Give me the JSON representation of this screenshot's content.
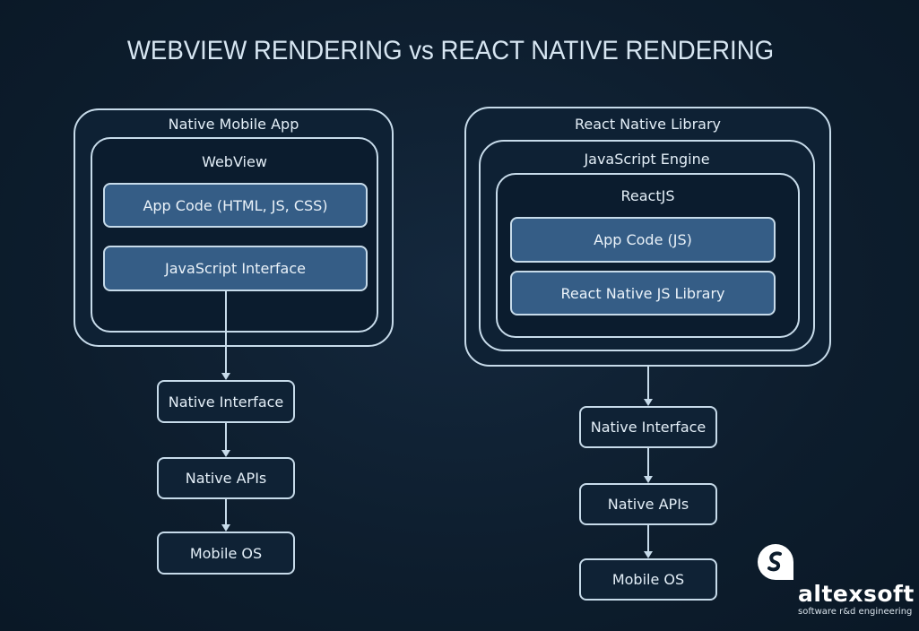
{
  "title": "WEBVIEW RENDERING vs REACT NATIVE RENDERING",
  "left": {
    "outer_label": "Native Mobile App",
    "inner_label": "WebView",
    "blocks": [
      "App Code (HTML, JS, CSS)",
      "JavaScript Interface"
    ],
    "chain": [
      "Native Interface",
      "Native APIs",
      "Mobile OS"
    ]
  },
  "right": {
    "outer_label": "React Native Library",
    "middle_label": "JavaScript Engine",
    "inner_label": "ReactJS",
    "blocks": [
      "App Code (JS)",
      "React Native JS Library"
    ],
    "chain": [
      "Native Interface",
      "Native APIs",
      "Mobile OS"
    ]
  },
  "brand": {
    "name": "altexsoft",
    "tagline": "software r&d engineering",
    "icon": "altexsoft-logo-icon"
  },
  "colors": {
    "background": "#0f2032",
    "stroke": "#c7dbea",
    "block_fill": "#355d86"
  }
}
